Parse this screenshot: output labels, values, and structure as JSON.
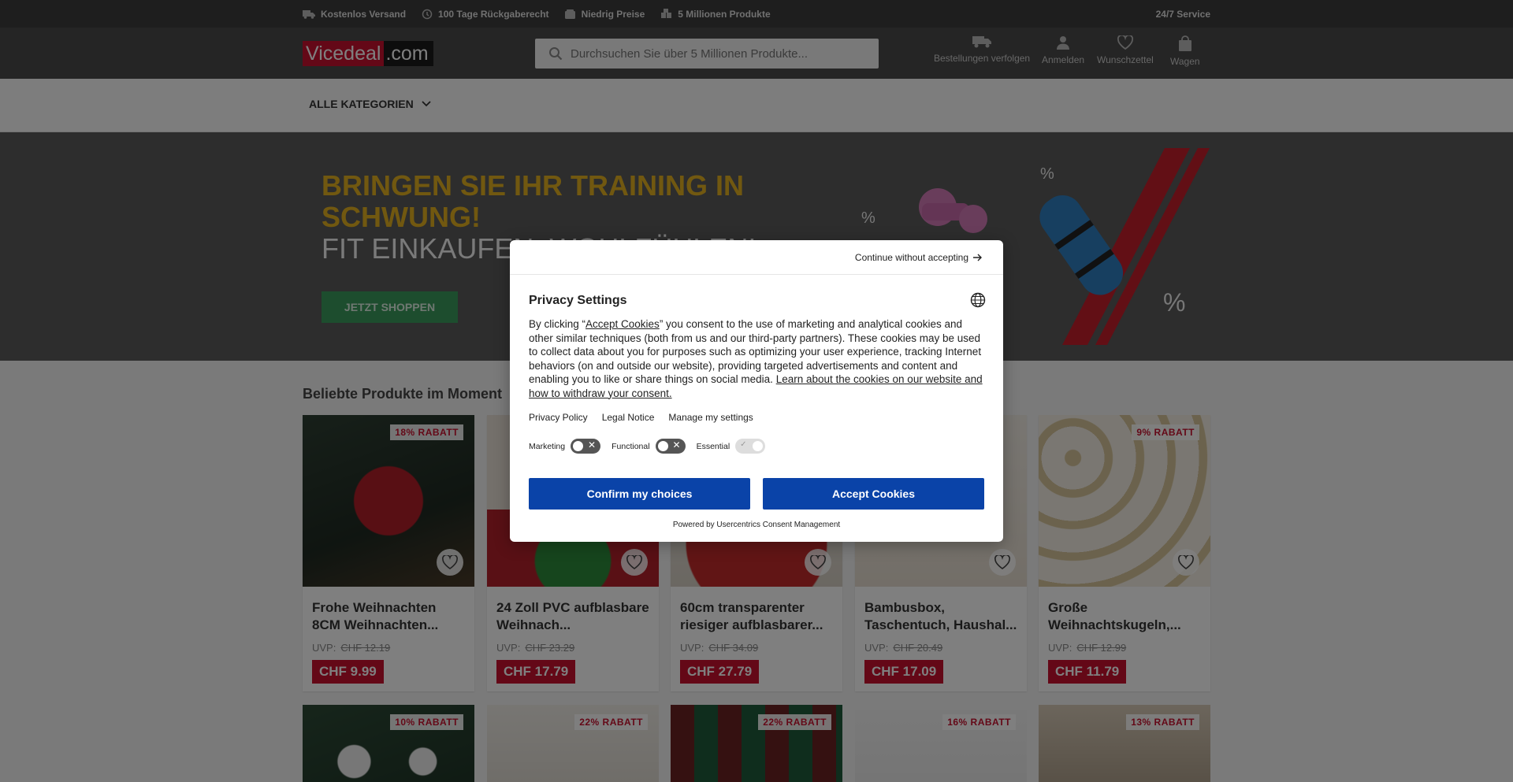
{
  "topbar": {
    "usps": [
      "Kostenlos Versand",
      "100 Tage Rückgaberecht",
      "Niedrig Preise",
      "5 Millionen Produkte"
    ],
    "service": "24/7 Service"
  },
  "header": {
    "logo_brand": "Vicedeal",
    "logo_tld": ".com",
    "search_placeholder": "Durchsuchen Sie über 5 Millionen Produkte...",
    "nav": {
      "orders": "Bestellungen verfolgen",
      "login": "Anmelden",
      "wishlist": "Wunschzettel",
      "cart": "Wagen"
    }
  },
  "catbar": {
    "label": "ALLE KATEGORIEN"
  },
  "hero": {
    "headline": "BRINGEN SIE IHR TRAINING IN SCHWUNG!",
    "subline": "FIT EINKAUFEN. WOHLFÜHLEN!",
    "cta": "JETZT SHOPPEN"
  },
  "products": {
    "section_title": "Beliebte Produkte im Moment",
    "uvp_label": "UVP:",
    "items": [
      {
        "badge": "18% RABATT",
        "name": "Frohe Weihnachten 8CM Weihnachten...",
        "uvp": "CHF 12.19",
        "price": "CHF 9.99"
      },
      {
        "badge": "",
        "name": "24 Zoll PVC aufblasbare Weihnach...",
        "uvp": "CHF 23.29",
        "price": "CHF 17.79"
      },
      {
        "badge": "",
        "name": "60cm transparenter riesiger aufblasbarer...",
        "uvp": "CHF 34.09",
        "price": "CHF 27.79"
      },
      {
        "badge": "",
        "name": "Bambusbox, Taschentuch, Haushal...",
        "uvp": "CHF 20.49",
        "price": "CHF 17.09"
      },
      {
        "badge": "9% RABATT",
        "name": "Große Weihnachtskugeln,...",
        "uvp": "CHF 12.99",
        "price": "CHF 11.79"
      }
    ],
    "row2_badges": [
      "10% RABATT",
      "22% RABATT",
      "22% RABATT",
      "16% RABATT",
      "13% RABATT"
    ]
  },
  "consent": {
    "continue": "Continue without accepting",
    "title": "Privacy Settings",
    "body_pre": "By clicking “",
    "body_link1": "Accept Cookies",
    "body_mid": "” you consent to the use of marketing and analytical cookies and other similar techniques (both from us and our third-party partners). These cookies may be used to collect data about you for purposes such as optimizing your user experience, tracking Internet behaviors (on and outside our website), providing targeted advertisements and content and enabling you to like or share things on social media. ",
    "body_link2": "Learn about the cookies on our website and how to withdraw your consent.",
    "links": [
      "Privacy Policy",
      "Legal Notice",
      "Manage my settings"
    ],
    "toggles": [
      {
        "label": "Marketing",
        "on": false
      },
      {
        "label": "Functional",
        "on": false
      },
      {
        "label": "Essential",
        "on": true
      }
    ],
    "confirm": "Confirm my choices",
    "accept": "Accept Cookies",
    "powered": "Powered by Usercentrics Consent Management"
  }
}
